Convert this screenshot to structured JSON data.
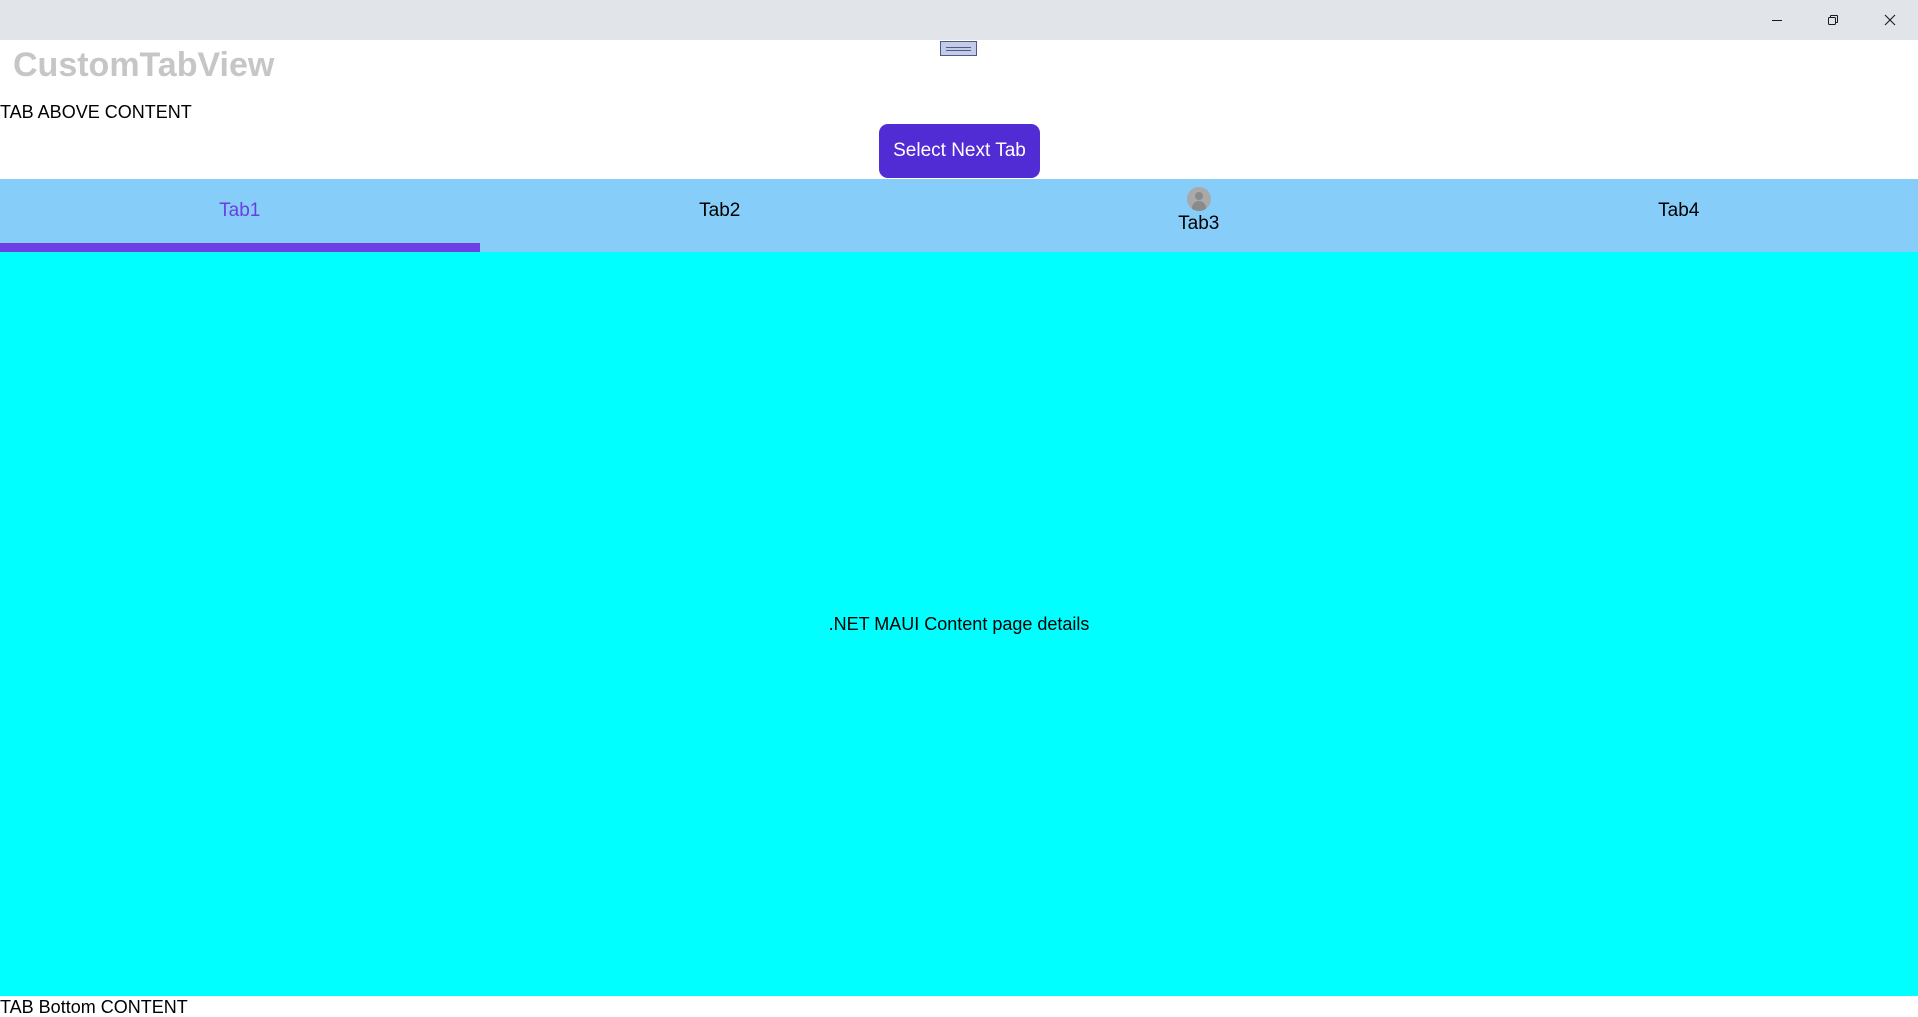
{
  "window": {
    "minimize_icon": "minimize-icon",
    "maximize_icon": "restore-icon",
    "close_icon": "close-icon",
    "titlebar_color": "#e1e4e8"
  },
  "header": {
    "title": "CustomTabView",
    "above_label": "TAB ABOVE CONTENT",
    "next_button_label": "Select Next Tab",
    "next_button_color": "#512bd4"
  },
  "tabs": {
    "strip_color": "#87cdf9",
    "indicator_color": "#6f3fe6",
    "selected_index": 0,
    "items": [
      {
        "label": "Tab1",
        "icon": null
      },
      {
        "label": "Tab2",
        "icon": null
      },
      {
        "label": "Tab3",
        "icon": "person-icon"
      },
      {
        "label": "Tab4",
        "icon": null
      }
    ]
  },
  "content": {
    "background_color": "#00ffff",
    "text": ".NET MAUI Content page details"
  },
  "footer": {
    "bottom_label": "TAB Bottom CONTENT"
  }
}
